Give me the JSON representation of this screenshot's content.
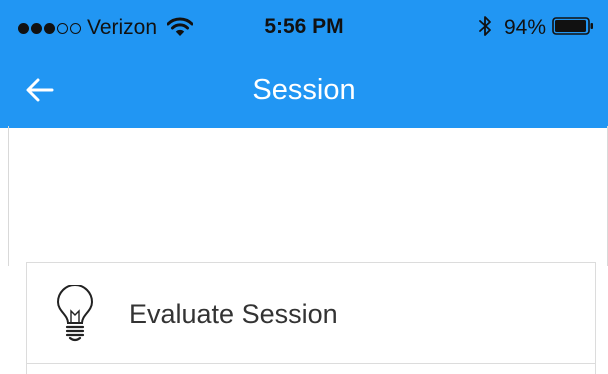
{
  "status_bar": {
    "carrier": "Verizon",
    "time": "5:56 PM",
    "battery_percent": "94%",
    "signal_bars_filled": 3,
    "signal_bars_total": 5
  },
  "nav": {
    "title": "Session"
  },
  "list": {
    "items": [
      {
        "label": "Evaluate Session",
        "icon": "lightbulb-icon"
      }
    ]
  },
  "colors": {
    "header_bg": "#2196f3",
    "header_text": "#ffffff",
    "status_text": "#111111",
    "item_text": "#333333",
    "border": "#dcdcdc"
  }
}
